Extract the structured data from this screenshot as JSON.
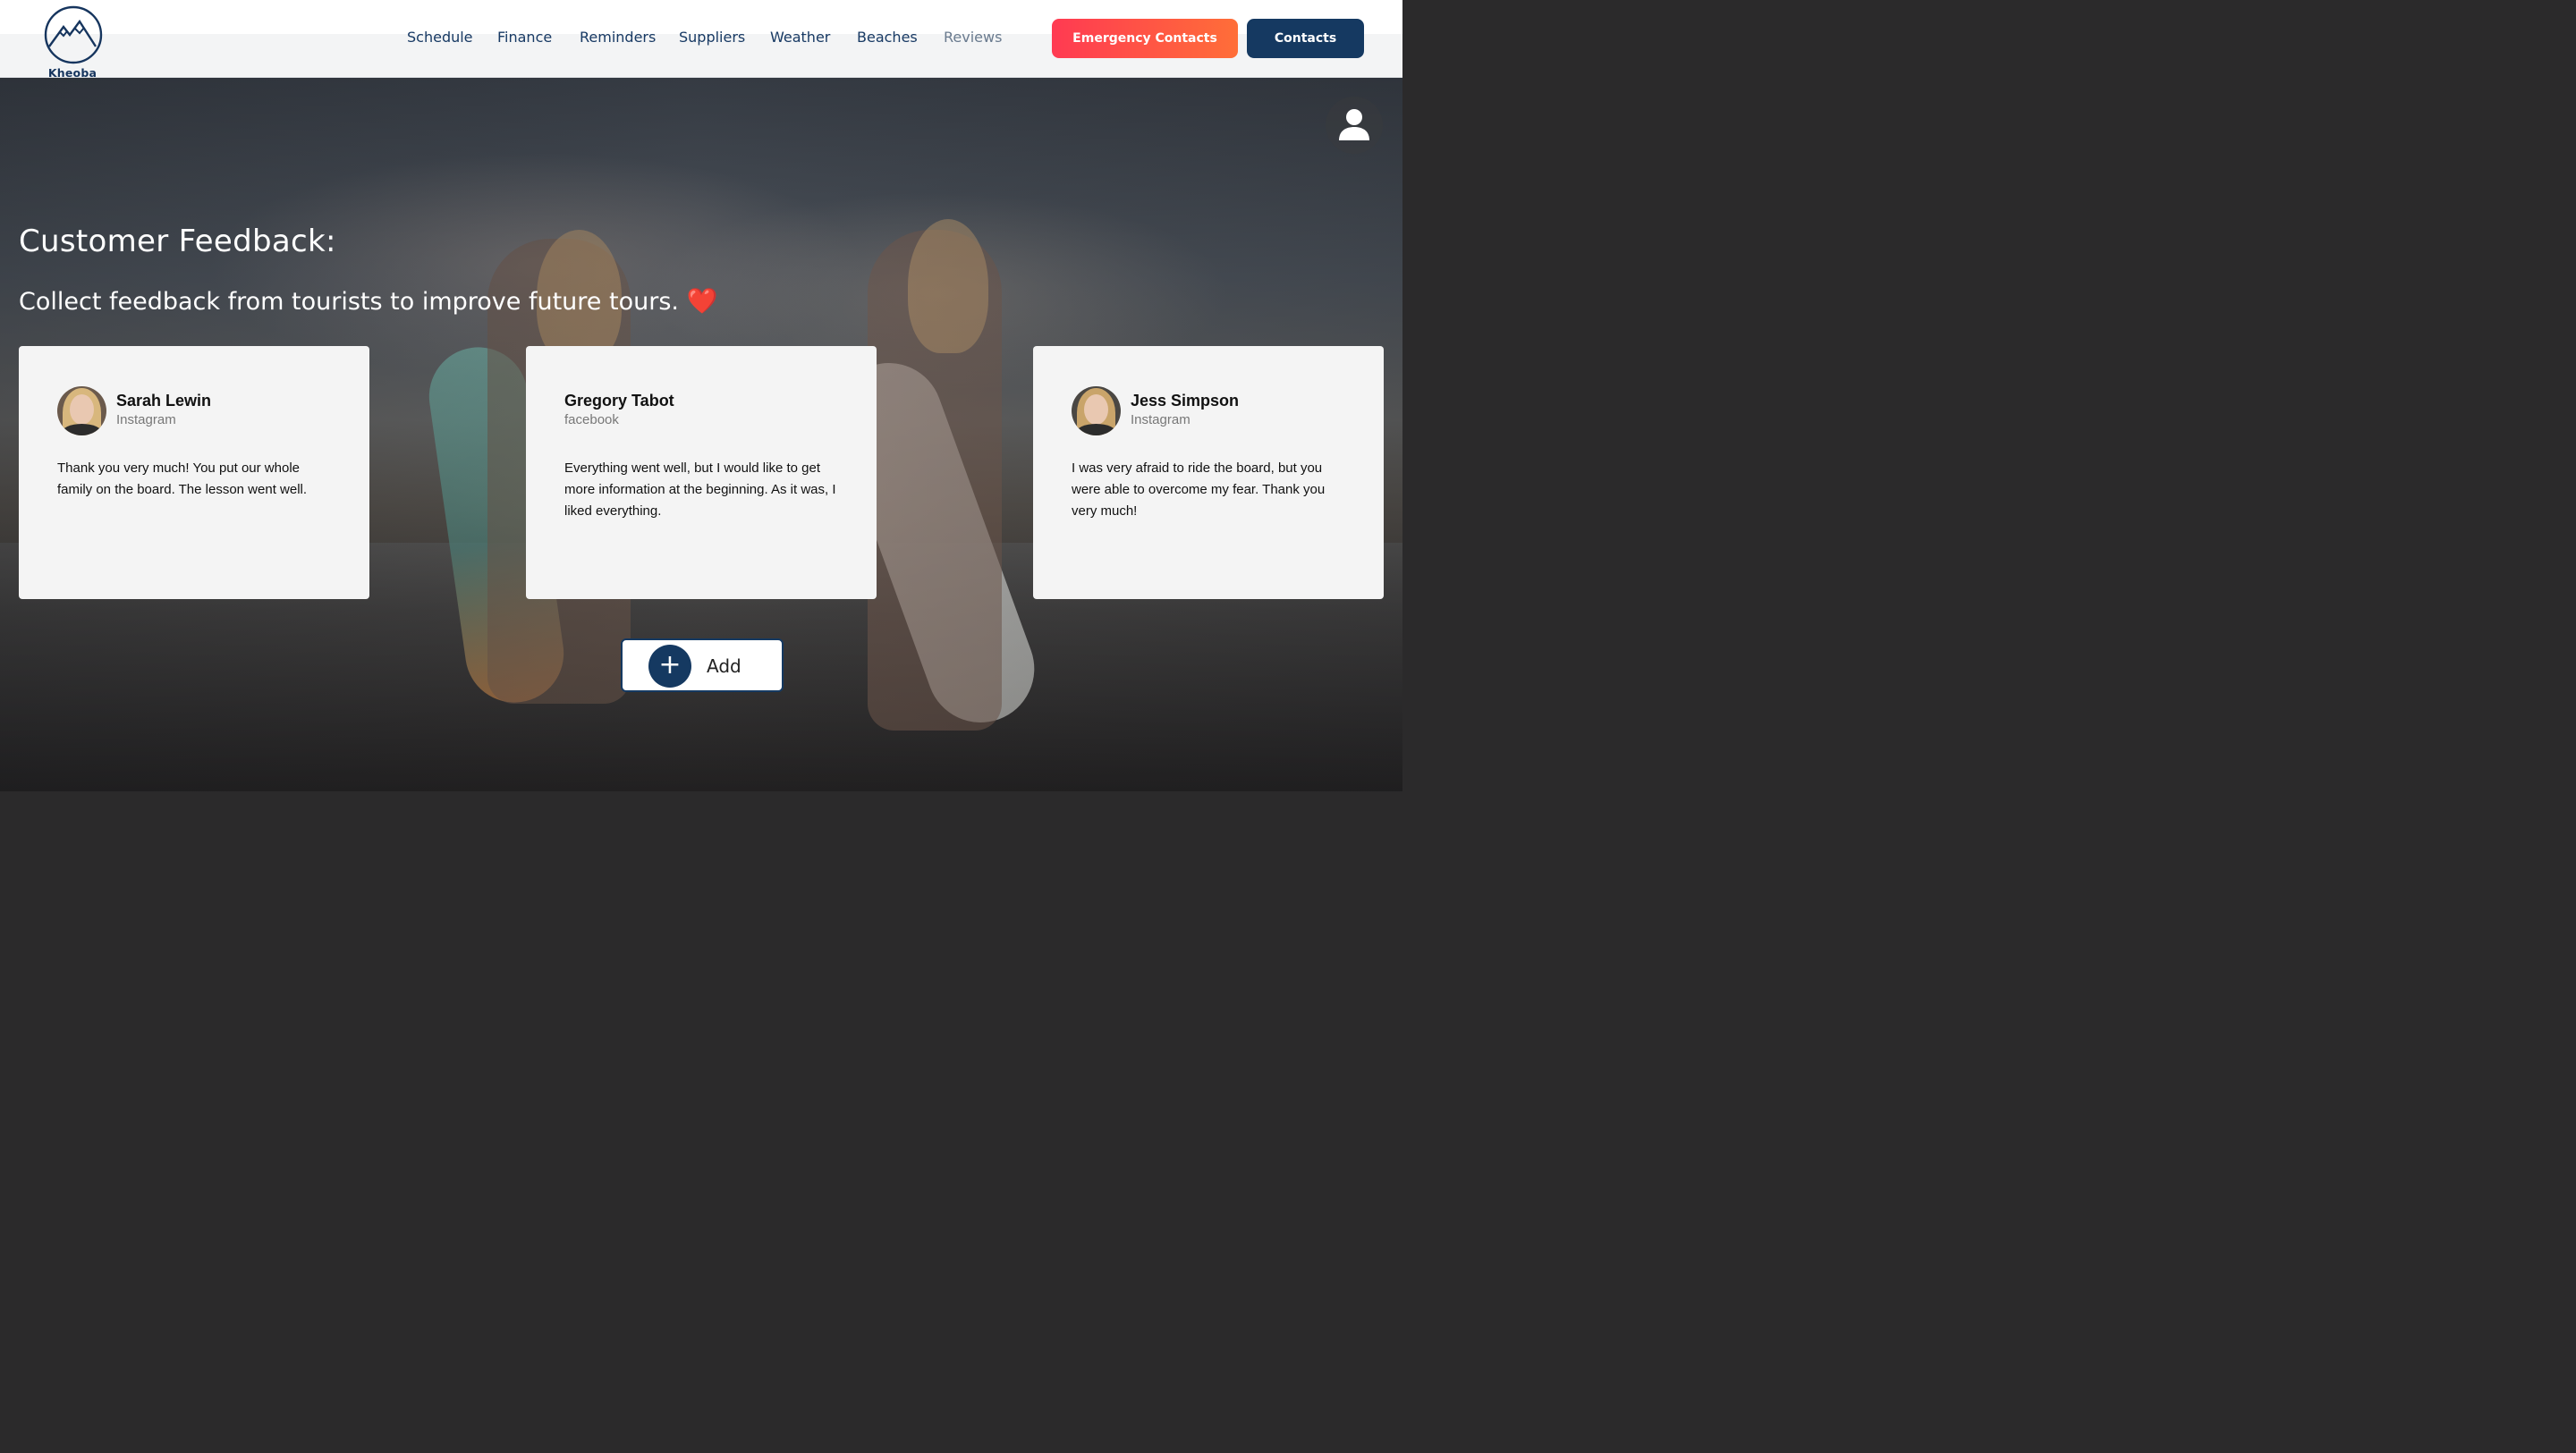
{
  "brand": {
    "name": "Kheoba"
  },
  "nav": {
    "items": [
      {
        "label": "Schedule"
      },
      {
        "label": "Finance"
      },
      {
        "label": "Reminders"
      },
      {
        "label": "Suppliers"
      },
      {
        "label": "Weather"
      },
      {
        "label": "Beaches"
      },
      {
        "label": "Reviews",
        "active": true
      }
    ]
  },
  "header": {
    "emergency_label": "Emergency Contacts",
    "contacts_label": "Contacts"
  },
  "main": {
    "title": "Customer Feedback:",
    "subtitle": "Collect feedback from tourists to improve future tours.",
    "subtitle_emoji": "❤️",
    "add_label": "Add",
    "add_icon": "+"
  },
  "reviews": [
    {
      "name": "Sarah Lewin",
      "source": "Instagram",
      "text": "Thank you very much! You put our whole family on the board. The lesson went well."
    },
    {
      "name": "Gregory Tabot",
      "source": "facebook",
      "text": "Everything went well, but I would like to get more information at the beginning. As it was, I liked everything."
    },
    {
      "name": "Jess Simpson",
      "source": "Instagram",
      "text": "I was very afraid to ride the board, but you were able to overcome my fear. Thank you very much!"
    }
  ],
  "colors": {
    "brand_navy": "#153961",
    "emergency_start": "#ff3a52",
    "emergency_end": "#ff6e38",
    "card_bg": "#f4f4f4"
  },
  "icons": {
    "logo": "mountain-logo-icon",
    "profile": "user-icon",
    "add": "plus-icon"
  }
}
